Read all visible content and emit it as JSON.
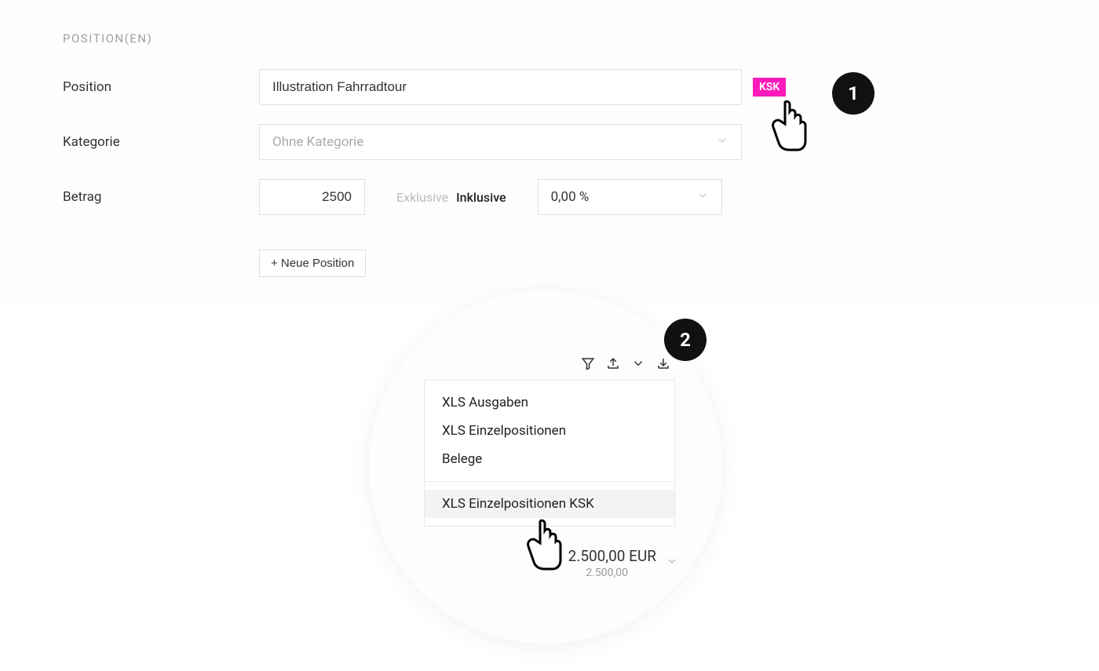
{
  "section_title": "POSITION(EN)",
  "labels": {
    "position": "Position",
    "kategorie": "Kategorie",
    "betrag": "Betrag"
  },
  "form": {
    "position_value": "Illustration Fahrradtour",
    "ksk_badge": "KSK",
    "kategorie_placeholder": "Ohne Kategorie",
    "betrag_value": "2500",
    "toggle_exclusive": "Exklusive",
    "toggle_inclusive": "Inklusive",
    "percent_value": "0,00 %"
  },
  "add_position_label": "+ Neue Position",
  "steps": {
    "one": "1",
    "two": "2"
  },
  "menu": {
    "items": [
      "XLS Ausgaben",
      "XLS Einzelpositionen",
      "Belege"
    ],
    "highlight": "XLS Einzelpositionen KSK"
  },
  "amount": {
    "main": "2.500,00 EUR",
    "sub": "2.500,00"
  }
}
